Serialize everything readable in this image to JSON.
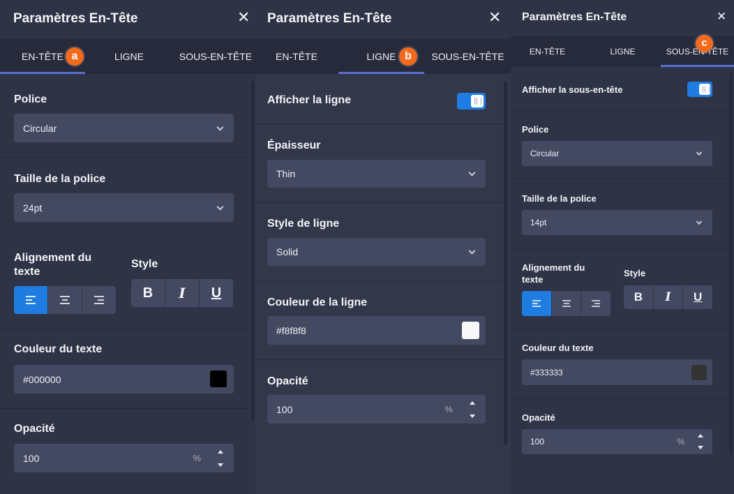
{
  "panel_a": {
    "title": "Paramètres En-Tête",
    "close": "✕",
    "tabs": [
      "EN-TÊTE",
      "LIGNE",
      "SOUS-EN-TÊTE"
    ],
    "badge": "a",
    "font_label": "Police",
    "font_value": "Circular",
    "size_label": "Taille de la police",
    "size_value": "24pt",
    "align_label": "Alignement du texte",
    "style_label": "Style",
    "bold": "B",
    "italic": "I",
    "underline": "U",
    "color_label": "Couleur du texte",
    "color_value": "#000000",
    "opacity_label": "Opacité",
    "opacity_value": "100",
    "opacity_unit": "%"
  },
  "panel_b": {
    "title": "Paramètres En-Tête",
    "close": "✕",
    "tabs": [
      "EN-TÊTE",
      "LIGNE",
      "SOUS-EN-TÊTE"
    ],
    "badge": "b",
    "show_line_label": "Afficher la ligne",
    "thickness_label": "Épaisseur",
    "thickness_value": "Thin",
    "line_style_label": "Style de ligne",
    "line_style_value": "Solid",
    "line_color_label": "Couleur de la ligne",
    "line_color_value": "#f8f8f8",
    "opacity_label": "Opacité",
    "opacity_value": "100",
    "opacity_unit": "%"
  },
  "panel_c": {
    "title": "Paramètres En-Tête",
    "close": "✕",
    "tabs": [
      "EN-TÊTE",
      "LIGNE",
      "SOUS-EN-TÊTE"
    ],
    "badge": "c",
    "show_sub_label": "Afficher la sous-en-tête",
    "font_label": "Police",
    "font_value": "Circular",
    "size_label": "Taille de la police",
    "size_value": "14pt",
    "align_label": "Alignement du texte",
    "style_label": "Style",
    "bold": "B",
    "italic": "I",
    "underline": "U",
    "color_label": "Couleur du texte",
    "color_value": "#333333",
    "opacity_label": "Opacité",
    "opacity_value": "100",
    "opacity_unit": "%"
  },
  "colors": {
    "accent": "#1f7ce0",
    "tab_underline": "#5a6fd1",
    "badge": "#f26b1d",
    "panel_bg": "#2f3346",
    "input_bg": "#444962"
  }
}
